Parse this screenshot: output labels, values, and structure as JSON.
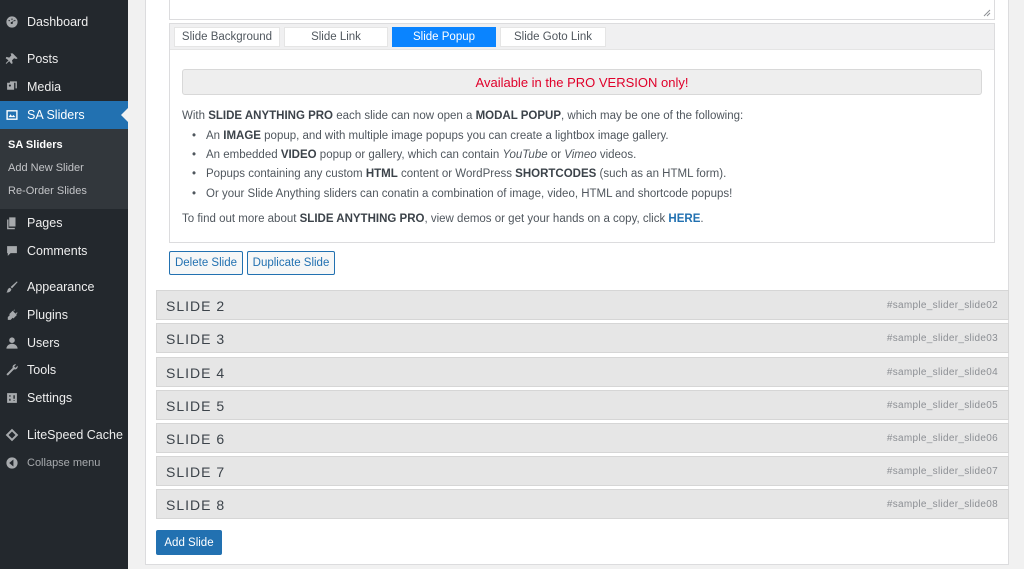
{
  "sidebar": {
    "items": [
      {
        "label": "Dashboard",
        "icon": "dashboard-icon"
      },
      {
        "label": "Posts",
        "icon": "pushpin-icon"
      },
      {
        "label": "Media",
        "icon": "media-icon"
      },
      {
        "label": "SA Sliders",
        "icon": "slides-icon"
      },
      {
        "label": "Pages",
        "icon": "pages-icon"
      },
      {
        "label": "Comments",
        "icon": "comments-icon"
      },
      {
        "label": "Appearance",
        "icon": "paintbrush-icon"
      },
      {
        "label": "Plugins",
        "icon": "plugins-icon"
      },
      {
        "label": "Users",
        "icon": "users-icon"
      },
      {
        "label": "Tools",
        "icon": "wrench-icon"
      },
      {
        "label": "Settings",
        "icon": "settings-icon"
      },
      {
        "label": "LiteSpeed Cache",
        "icon": "litespeed-icon"
      }
    ],
    "submenu": [
      "SA Sliders",
      "Add New Slider",
      "Re-Order Slides"
    ],
    "collapse_label": "Collapse menu"
  },
  "tabs": [
    "Slide Background",
    "Slide Link",
    "Slide Popup",
    "Slide Goto Link"
  ],
  "active_tab": "Slide Popup",
  "popup_tab": {
    "pro_banner": "Available in the PRO VERSION only!",
    "intro_pre": "With ",
    "intro_bold1": "SLIDE ANYTHING PRO",
    "intro_mid": " each slide can now open a ",
    "intro_bold2": "MODAL POPUP",
    "intro_post": ", which may be one of the following:",
    "b1_pre": "An ",
    "b1_bold": "IMAGE",
    "b1_post": " popup, and with multiple image popups you can create a lightbox image gallery.",
    "b2_pre": "An embedded ",
    "b2_bold": "VIDEO",
    "b2_mid": " popup or gallery, which can contain ",
    "b2_i1": "YouTube",
    "b2_or": " or ",
    "b2_i2": "Vimeo",
    "b2_post": " videos.",
    "b3_pre": "Popups containing any custom ",
    "b3_bold1": "HTML",
    "b3_mid": " content or WordPress ",
    "b3_bold2": "SHORTCODES",
    "b3_post": " (such as an HTML form).",
    "b4": "Or your Slide Anything sliders can conatin a combination of image, video, HTML and shortcode popups!",
    "outro_pre": "To find out more about ",
    "outro_bold": "SLIDE ANYTHING PRO",
    "outro_mid": ", view demos or get your hands on a copy, click ",
    "outro_link": "HERE",
    "outro_post": "."
  },
  "buttons": {
    "delete": "Delete Slide",
    "duplicate": "Duplicate Slide",
    "add": "Add Slide"
  },
  "slides": [
    {
      "label": "SLIDE 2",
      "id": "#sample_slider_slide02"
    },
    {
      "label": "SLIDE 3",
      "id": "#sample_slider_slide03"
    },
    {
      "label": "SLIDE 4",
      "id": "#sample_slider_slide04"
    },
    {
      "label": "SLIDE 5",
      "id": "#sample_slider_slide05"
    },
    {
      "label": "SLIDE 6",
      "id": "#sample_slider_slide06"
    },
    {
      "label": "SLIDE 7",
      "id": "#sample_slider_slide07"
    },
    {
      "label": "SLIDE 8",
      "id": "#sample_slider_slide08"
    }
  ],
  "colors": {
    "sidebar_bg": "#23282d",
    "accent": "#2271b1",
    "active_tab": "#0a84ff",
    "pro_text": "#e0002a"
  }
}
